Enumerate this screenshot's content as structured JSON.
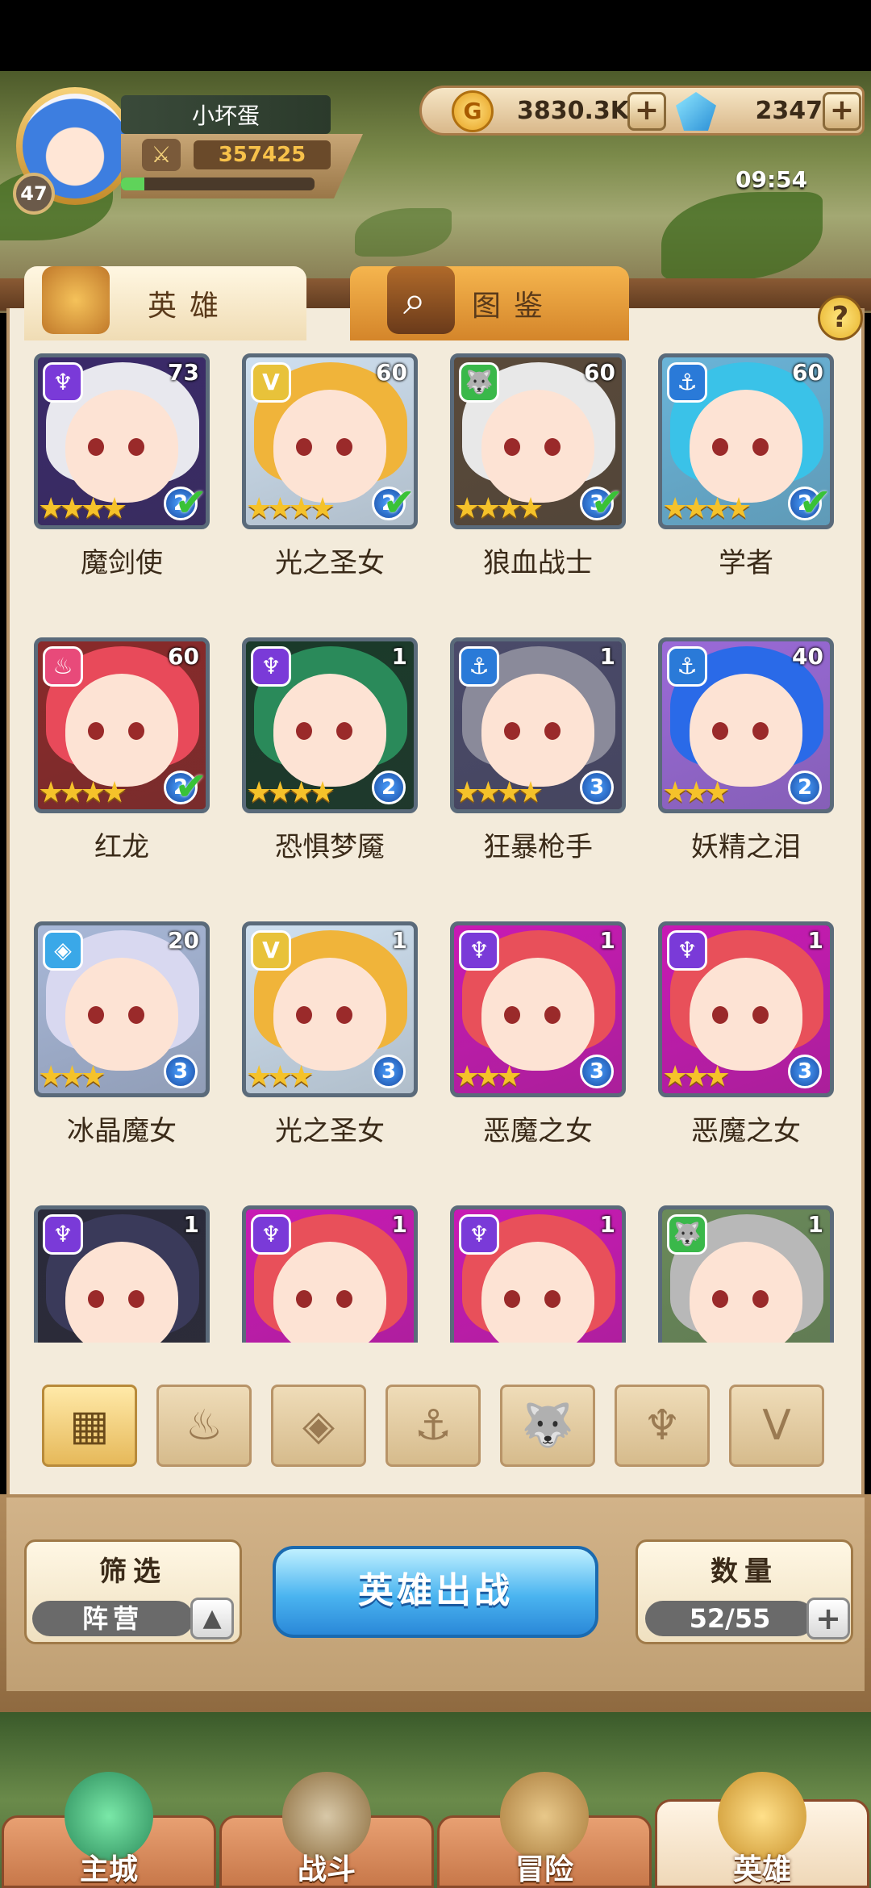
{
  "player": {
    "name": "小坏蛋",
    "level": "47",
    "power": "357425",
    "exp_fraction": 0.12
  },
  "resources": {
    "gold": "3830.3K",
    "gems": "2347"
  },
  "clock": "09:54",
  "tabs": {
    "heroes": "英雄",
    "codex": "图鉴"
  },
  "help_label": "?",
  "heroes": [
    {
      "name": "魔剑使",
      "level": "73",
      "stars": 4,
      "rank": "2",
      "deployed": true,
      "element": "dark",
      "hair": "#e8e8ee",
      "bg": "#3a2a6a"
    },
    {
      "name": "光之圣女",
      "level": "60",
      "stars": 4,
      "rank": "2",
      "deployed": true,
      "element": "light",
      "hair": "#f0b43a",
      "bg": "#cfe0f0"
    },
    {
      "name": "狼血战士",
      "level": "60",
      "stars": 4,
      "rank": "3",
      "deployed": true,
      "element": "nature",
      "hair": "#e8e8e8",
      "bg": "#5a4a3a"
    },
    {
      "name": "学者",
      "level": "60",
      "stars": 4,
      "rank": "2",
      "deployed": true,
      "element": "water",
      "hair": "#3ac2e8",
      "bg": "#6ab4d8"
    },
    {
      "name": "红龙",
      "level": "60",
      "stars": 4,
      "rank": "2",
      "deployed": true,
      "element": "fire",
      "hair": "#e84a5a",
      "bg": "#8a2a2a"
    },
    {
      "name": "恐惧梦魇",
      "level": "1",
      "stars": 4,
      "rank": "2",
      "deployed": false,
      "element": "dark",
      "hair": "#2a8a5a",
      "bg": "#1a3a2a"
    },
    {
      "name": "狂暴枪手",
      "level": "1",
      "stars": 4,
      "rank": "3",
      "deployed": false,
      "element": "water",
      "hair": "#8a8a9a",
      "bg": "#4a4a6a"
    },
    {
      "name": "妖精之泪",
      "level": "40",
      "stars": 3,
      "rank": "2",
      "deployed": false,
      "element": "water",
      "hair": "#2a6ae8",
      "bg": "#9a6ad8"
    },
    {
      "name": "冰晶魔女",
      "level": "20",
      "stars": 3,
      "rank": "3",
      "deployed": false,
      "element": "ice",
      "hair": "#d8d8f0",
      "bg": "#a8b8d8"
    },
    {
      "name": "光之圣女",
      "level": "1",
      "stars": 3,
      "rank": "3",
      "deployed": false,
      "element": "light",
      "hair": "#f0b43a",
      "bg": "#cfe0f0"
    },
    {
      "name": "恶魔之女",
      "level": "1",
      "stars": 3,
      "rank": "3",
      "deployed": false,
      "element": "dark",
      "hair": "#e8505a",
      "bg": "#c81ab4"
    },
    {
      "name": "恶魔之女",
      "level": "1",
      "stars": 3,
      "rank": "3",
      "deployed": false,
      "element": "dark",
      "hair": "#e8505a",
      "bg": "#c81ab4"
    },
    {
      "name": "",
      "level": "1",
      "stars": 0,
      "rank": "",
      "deployed": false,
      "element": "dark",
      "hair": "#3a3a5a",
      "bg": "#2a2a3a"
    },
    {
      "name": "",
      "level": "1",
      "stars": 0,
      "rank": "",
      "deployed": false,
      "element": "dark",
      "hair": "#e8505a",
      "bg": "#c81ab4"
    },
    {
      "name": "",
      "level": "1",
      "stars": 0,
      "rank": "",
      "deployed": false,
      "element": "dark",
      "hair": "#e8505a",
      "bg": "#c81ab4"
    },
    {
      "name": "",
      "level": "1",
      "stars": 0,
      "rank": "",
      "deployed": false,
      "element": "nature",
      "hair": "#b8b8b8",
      "bg": "#6a8a5a"
    }
  ],
  "element_colors": {
    "dark": "#7a3ad8",
    "light": "#e8c23a",
    "nature": "#3ab84a",
    "water": "#2a7ad8",
    "fire": "#e84a7a",
    "ice": "#3aa8e8"
  },
  "element_glyphs": {
    "dark": "♆",
    "light": "V",
    "nature": "🐺",
    "water": "⚓",
    "fire": "♨",
    "ice": "◈"
  },
  "filters": [
    {
      "icon": "grid-icon",
      "glyph": "▦",
      "active": true
    },
    {
      "icon": "fire-element-icon",
      "glyph": "♨",
      "active": false
    },
    {
      "icon": "ice-element-icon",
      "glyph": "◈",
      "active": false
    },
    {
      "icon": "water-element-icon",
      "glyph": "⚓",
      "active": false
    },
    {
      "icon": "nature-element-icon",
      "glyph": "🐺",
      "active": false
    },
    {
      "icon": "dark-element-icon",
      "glyph": "♆",
      "active": false
    },
    {
      "icon": "light-element-icon",
      "glyph": "V",
      "active": false
    }
  ],
  "controls": {
    "filter_title": "筛选",
    "filter_value": "阵营",
    "deploy_label": "英雄出战",
    "count_title": "数量",
    "count_value": "52/55"
  },
  "nav": [
    {
      "label": "主城",
      "active": false
    },
    {
      "label": "战斗",
      "active": false
    },
    {
      "label": "冒险",
      "active": false
    },
    {
      "label": "英雄",
      "active": true
    }
  ]
}
